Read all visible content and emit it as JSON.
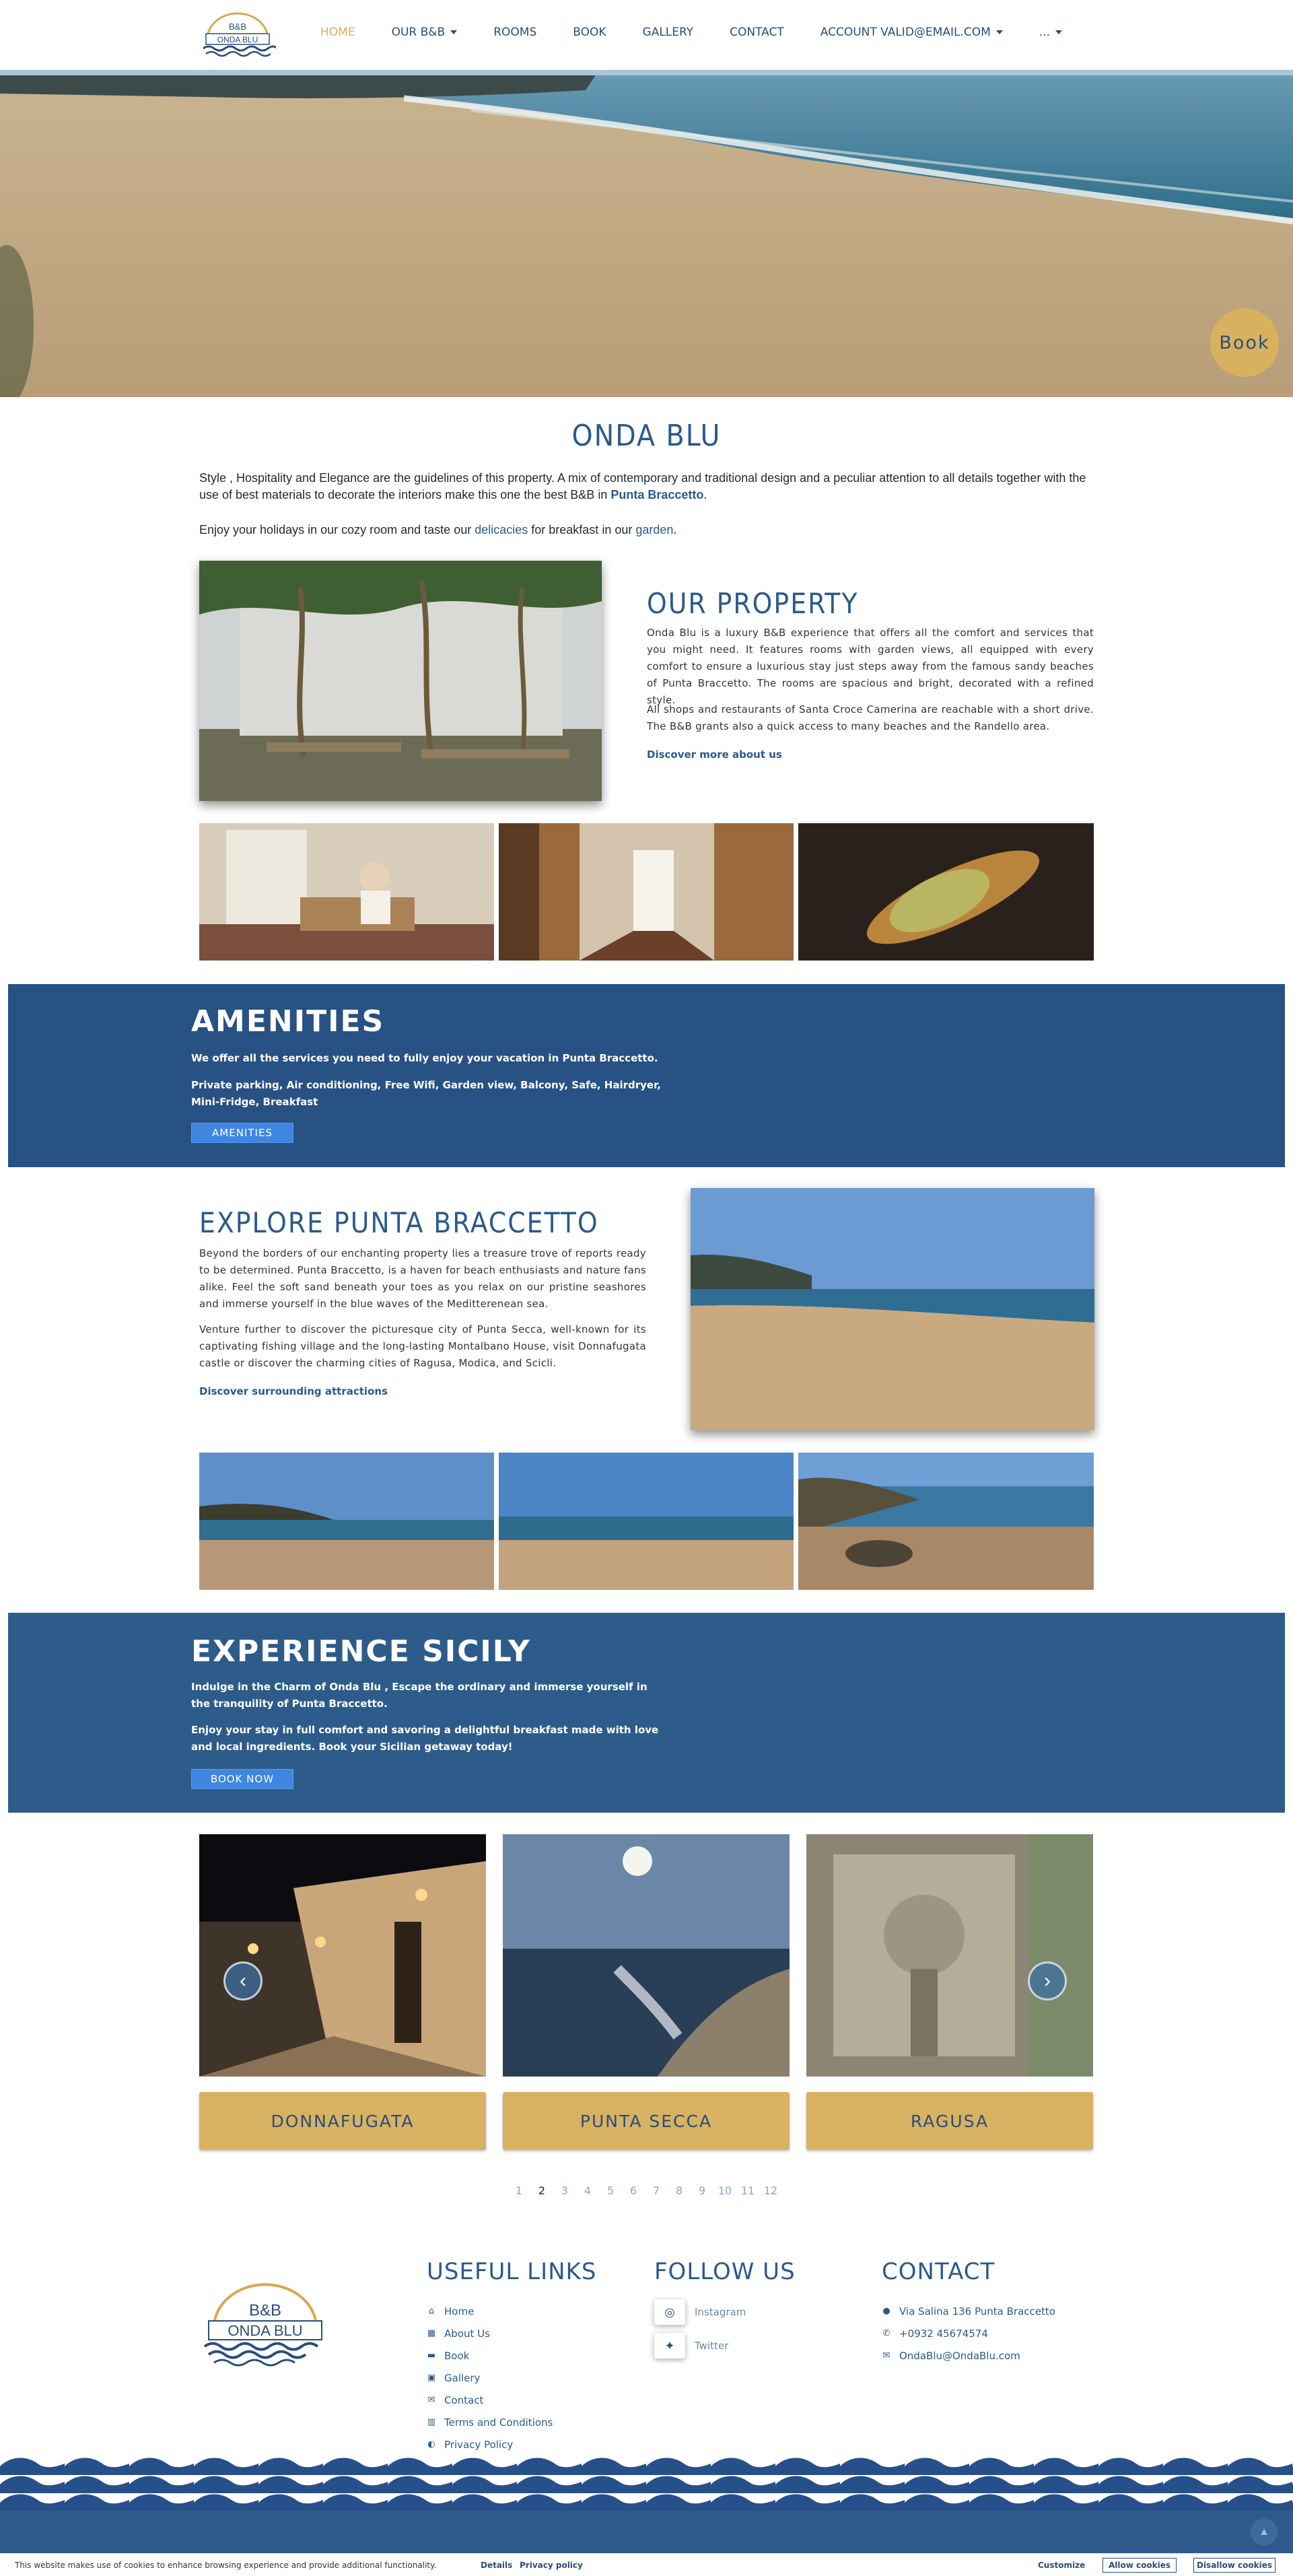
{
  "nav": {
    "logo_top": "B&B",
    "logo_bottom": "ONDA BLU",
    "items": [
      "HOME",
      "OUR B&B",
      "ROOMS",
      "BOOK",
      "GALLERY",
      "CONTACT",
      "ACCOUNT VALID@EMAIL.COM",
      "..."
    ]
  },
  "hero": {
    "book_label": "Book"
  },
  "intro": {
    "title": "ONDA BLU",
    "p1_text": "Style , Hospitality and Elegance are the guidelines of this property. A mix of contemporary and traditional design and a peculiar attention to all details together with the use of best materials to decorate the interiors make this one the best B&B in ",
    "p1_link": "Punta Braccetto",
    "p1_end": ".",
    "p2_a": "Enjoy your holidays in our cozy room and taste our ",
    "p2_link1": "delicacies",
    "p2_b": " for breakfast in our ",
    "p2_link2": "garden",
    "p2_end": "."
  },
  "property": {
    "title": "OUR PROPERTY",
    "p1": "Onda Blu is a luxury B&B experience that offers all the comfort and services that you might need. It features rooms with garden views, all equipped with every comfort to ensure a luxurious stay just steps away from the famous sandy beaches of Punta Braccetto. The rooms are spacious and bright, decorated with a refined style.",
    "p2": "All shops and restaurants of Santa Croce Camerina are reachable with a short drive. The B&B grants also a quick access to many beaches and the Randello area.",
    "link": "Discover more about us"
  },
  "amenities": {
    "title": "AMENITIES",
    "p1": "We offer all the services you need to fully enjoy your vacation in Punta Braccetto.",
    "p2": "Private parking, Air conditioning, Free Wifi, Garden view, Balcony, Safe, Hairdryer, Mini-Fridge, Breakfast",
    "button": "AMENITIES"
  },
  "explore": {
    "title": "EXPLORE PUNTA BRACCETTO",
    "p1": "Beyond the borders of our enchanting property lies a treasure trove of reports ready to be determined. Punta Braccetto, is a haven for beach enthusiasts and nature fans alike. Feel the soft sand beneath your toes as you relax on our pristine seashores and immerse yourself in the blue waves of the Meditterenean sea.",
    "p2": "Venture further to discover the picturesque city of Punta Secca, well-known for its captivating fishing village and the long-lasting Montalbano House, visit Donnafugata castle or discover the charming cities of Ragusa, Modica, and Scicli.",
    "link": "Discover surrounding attractions"
  },
  "sicily": {
    "title": "EXPERIENCE SICILY",
    "p1": "Indulge in the Charm of Onda Blu , Escape the ordinary and immerse yourself in the tranquility of Punta Braccetto.",
    "p2": "Enjoy your stay in full comfort and savoring a delightful breakfast made with love and local ingredients. Book your Sicilian getaway today!",
    "button": "BOOK NOW"
  },
  "carousel": {
    "cards": [
      "DONNAFUGATA",
      "PUNTA SECCA",
      "RAGUSA"
    ],
    "pages": [
      "1",
      "2",
      "3",
      "4",
      "5",
      "6",
      "7",
      "8",
      "9",
      "10",
      "11",
      "12"
    ],
    "current_page": "2"
  },
  "footer": {
    "useful_title": "USEFUL LINKS",
    "links": [
      "Home",
      "About Us",
      "Book",
      "Gallery",
      "Contact",
      "Terms and Conditions",
      "Privacy Policy"
    ],
    "follow_title": "FOLLOW US",
    "social": [
      "Instagram",
      "Twitter"
    ],
    "contact_title": "CONTACT",
    "address": "Via Salina 136 Punta Braccetto",
    "phone": "+0932 45674574",
    "email": "OndaBlu@OndaBlu.com"
  },
  "cookie": {
    "text": "This website makes use of cookies to enhance browsing experience and provide additional functionality.",
    "details": "Details",
    "privacy": "Privacy policy",
    "customize": "Customize",
    "allow": "Allow cookies",
    "disallow": "Disallow cookies"
  },
  "colors": {
    "navy": "#2a4d7c",
    "gold": "#d7b262",
    "band": "#285184"
  }
}
